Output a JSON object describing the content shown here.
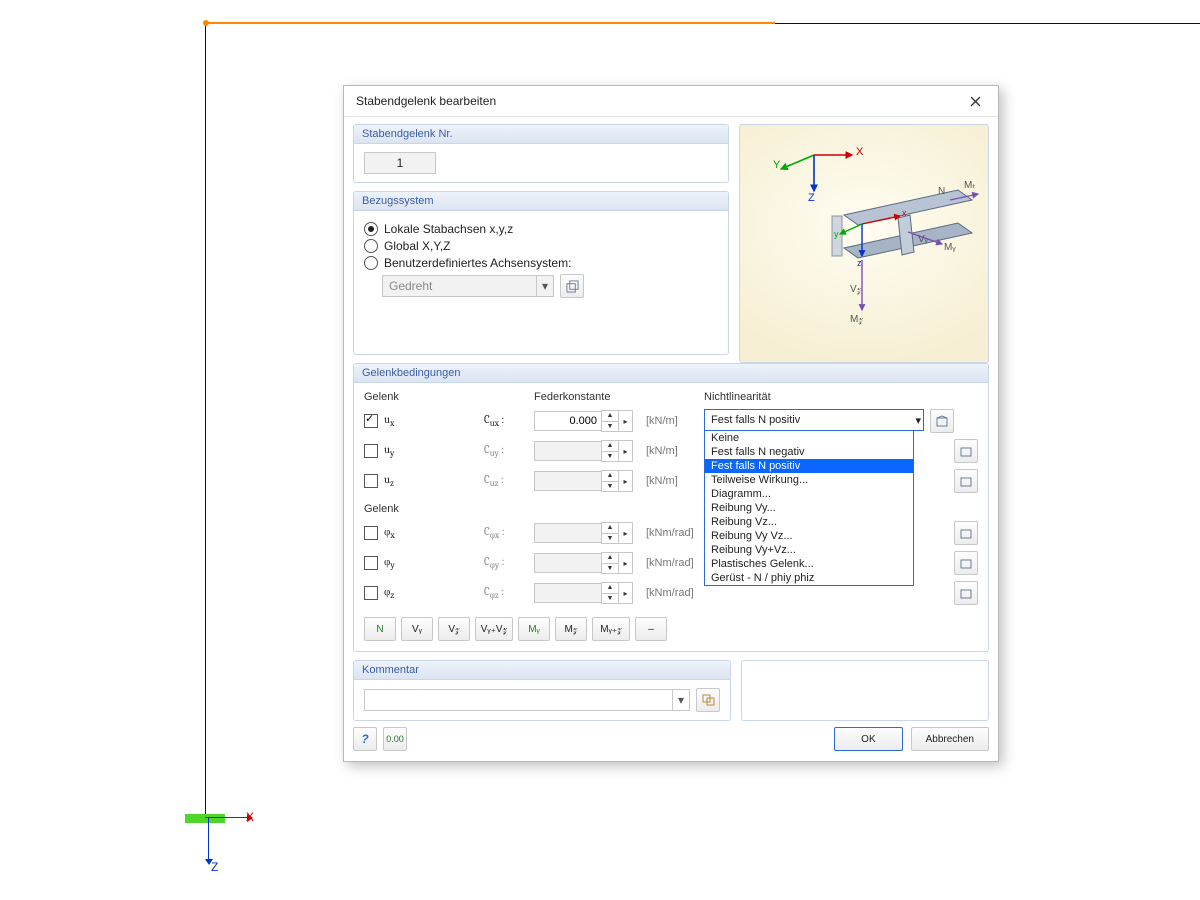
{
  "dialog": {
    "title": "Stabendgelenk bearbeiten",
    "numberSection": "Stabendgelenk Nr.",
    "number": "1",
    "refSystem": {
      "title": "Bezugssystem",
      "opt": [
        "Lokale Stabachsen x,y,z",
        "Global X,Y,Z",
        "Benutzerdefiniertes Achsensystem:"
      ],
      "selected": 0,
      "userCombo": "Gedreht"
    },
    "conditions": {
      "title": "Gelenkbedingungen",
      "hdr": [
        "Gelenk",
        "Federkonstante",
        "Nichtlinearität"
      ],
      "trans": [
        {
          "dof": "u",
          "sub": "x",
          "checked": true,
          "sym": "C",
          "value": "0.000",
          "unit": "[kN/m]"
        },
        {
          "dof": "u",
          "sub": "y",
          "checked": false,
          "sym": "C",
          "value": "",
          "unit": "[kN/m]"
        },
        {
          "dof": "u",
          "sub": "z",
          "checked": false,
          "sym": "C",
          "value": "",
          "unit": "[kN/m]"
        }
      ],
      "transHdr2": "Gelenk",
      "rot": [
        {
          "dof": "φ",
          "sub": "x",
          "checked": false,
          "sym": "C",
          "value": "",
          "unit": "[kNm/rad]"
        },
        {
          "dof": "φ",
          "sub": "y",
          "checked": false,
          "sym": "C",
          "value": "",
          "unit": "[kNm/rad]"
        },
        {
          "dof": "φ",
          "sub": "z",
          "checked": false,
          "sym": "C",
          "value": "",
          "unit": "[kNm/rad]"
        }
      ],
      "nlSelected": "Fest falls N positiv",
      "nlOptions": [
        "Keine",
        "Fest falls N negativ",
        "Fest falls N positiv",
        "Teilweise Wirkung...",
        "Diagramm...",
        "Reibung Vy...",
        "Reibung Vz...",
        "Reibung Vy Vz...",
        "Reibung Vy+Vz...",
        "Plastisches Gelenk...",
        "Gerüst - N / phiy phiz"
      ]
    },
    "quick": [
      "N",
      "Vᵧ",
      "V𝓏",
      "Vᵧ₊V𝓏",
      "Mᵧ",
      "M𝓏",
      "Mᵧ₊𝓏",
      "–"
    ],
    "commentTitle": "Kommentar",
    "comment": "",
    "ok": "OK",
    "cancel": "Abbrechen"
  },
  "bg": {
    "axisX": "X",
    "axisZ": "Z",
    "illus": {
      "X": "X",
      "Y": "Y",
      "Z": "Z",
      "N": "N",
      "MT": "M_T",
      "Vy": "V_y",
      "My": "M_y",
      "Vz": "V_z",
      "Mz": "M_z"
    }
  }
}
